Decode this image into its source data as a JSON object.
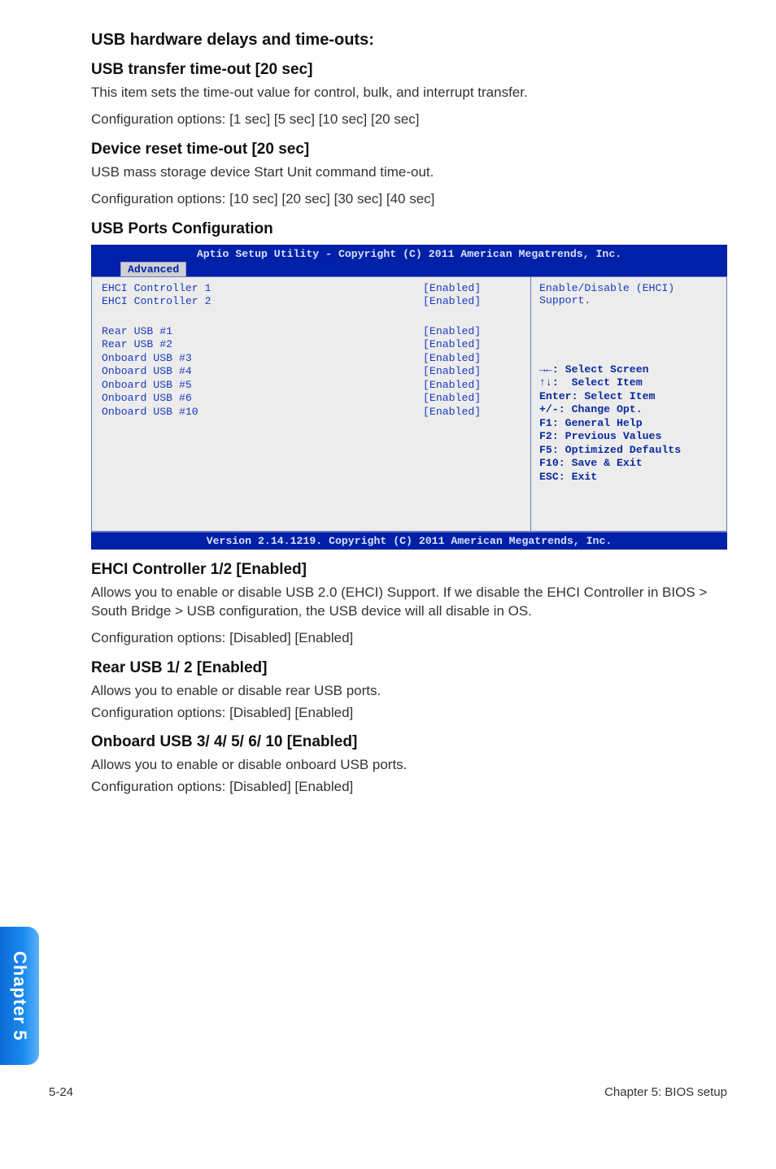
{
  "sections": {
    "s1_h": "USB hardware delays and time-outs:",
    "s2_h": "USB transfer time-out [20 sec]",
    "s2_p1": "This item sets the time-out value for control, bulk, and interrupt transfer.",
    "s2_p2": "Configuration options: [1 sec] [5 sec] [10 sec] [20 sec]",
    "s3_h": "Device reset time-out [20 sec]",
    "s3_p1": "USB mass storage device Start Unit command time-out.",
    "s3_p2": "Configuration options: [10 sec] [20 sec] [30 sec] [40 sec]",
    "s4_h": "USB Ports Configuration",
    "s5_h": "EHCI Controller 1/2 [Enabled]",
    "s5_p1": "Allows you to enable or disable USB 2.0 (EHCI) Support. If we disable the EHCI Controller in BIOS > South Bridge > USB configuration, the USB device will all disable in OS.",
    "s5_p2": "Configuration options: [Disabled] [Enabled]",
    "s6_h": "Rear USB 1/ 2 [Enabled]",
    "s6_p1": "Allows you to enable or disable rear USB ports.",
    "s6_p2": "Configuration options: [Disabled] [Enabled]",
    "s7_h": "Onboard USB 3/ 4/ 5/ 6/ 10 [Enabled]",
    "s7_p1": "Allows you to enable or disable onboard USB ports.",
    "s7_p2": "Configuration options: [Disabled] [Enabled]"
  },
  "bios": {
    "title": "Aptio Setup Utility - Copyright (C) 2011 American Megatrends, Inc.",
    "tab": "Advanced",
    "rows_top": [
      {
        "label": "EHCI Controller 1",
        "value": "[Enabled]"
      },
      {
        "label": "EHCI Controller 2",
        "value": "[Enabled]"
      }
    ],
    "rows_bottom": [
      {
        "label": "Rear USB #1",
        "value": "[Enabled]"
      },
      {
        "label": "Rear USB #2",
        "value": "[Enabled]"
      },
      {
        "label": "Onboard USB #3",
        "value": "[Enabled]"
      },
      {
        "label": "Onboard USB #4",
        "value": "[Enabled]"
      },
      {
        "label": "Onboard USB #5",
        "value": "[Enabled]"
      },
      {
        "label": "Onboard USB #6",
        "value": "[Enabled]"
      },
      {
        "label": "Onboard USB #10",
        "value": "[Enabled]"
      }
    ],
    "desc": "Enable/Disable (EHCI) Support.",
    "help": "→←: Select Screen\n↑↓:  Select Item\nEnter: Select Item\n+/-: Change Opt.\nF1: General Help\nF2: Previous Values\nF5: Optimized Defaults\nF10: Save & Exit\nESC: Exit",
    "footer": "Version 2.14.1219. Copyright (C) 2011 American Megatrends, Inc."
  },
  "side_tab": "Chapter 5",
  "footer": {
    "page": "5-24",
    "chapter": "Chapter 5: BIOS setup"
  }
}
